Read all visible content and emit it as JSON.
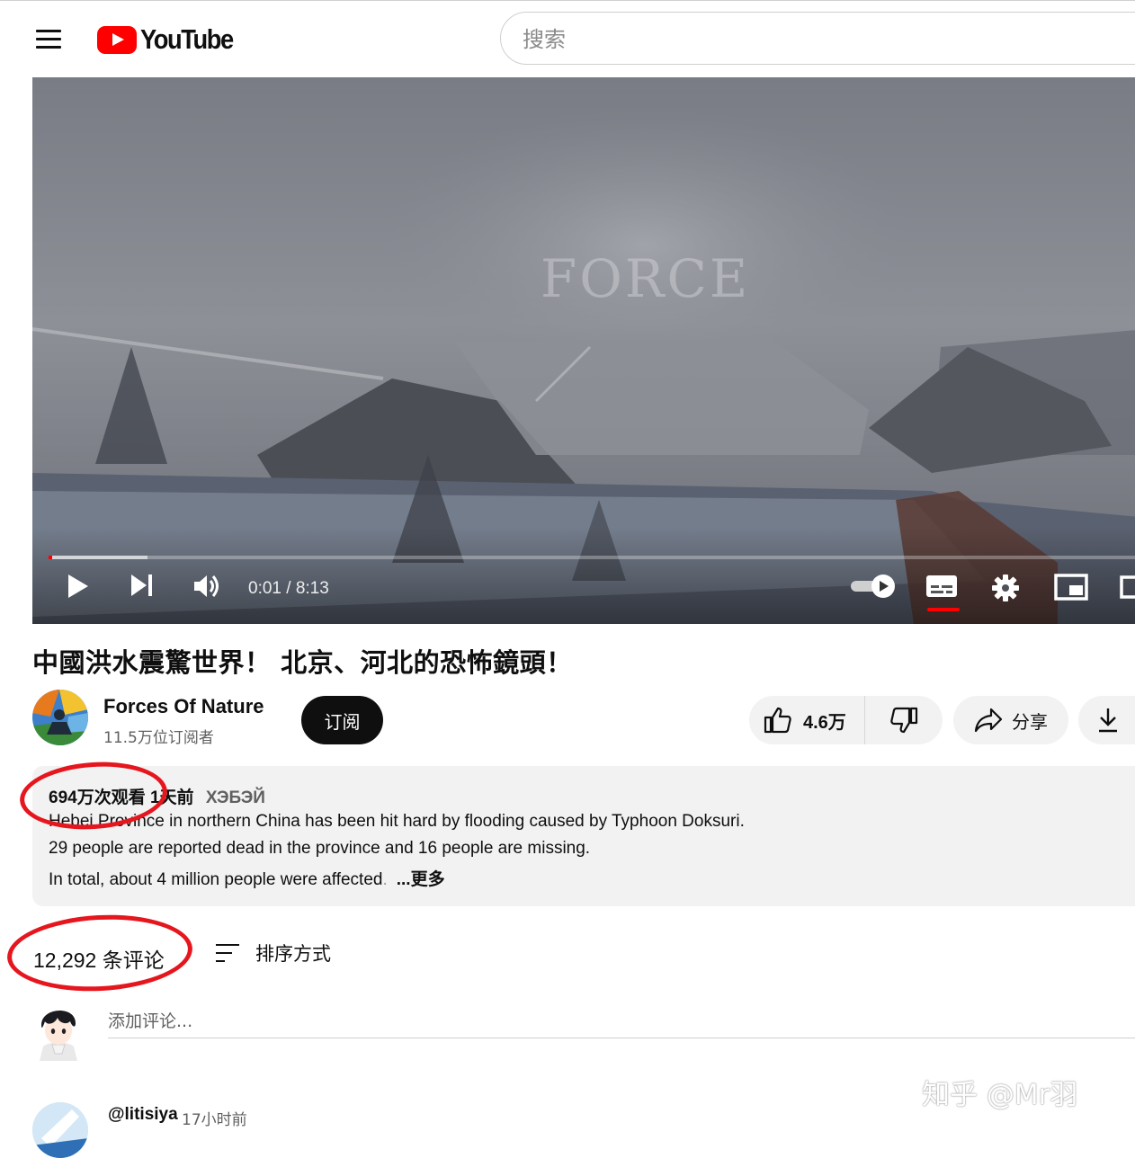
{
  "header": {
    "logo_text": "YouTube",
    "search_placeholder": "搜索"
  },
  "player": {
    "watermark_text": "FORCE",
    "time_current": "0:01",
    "time_total": "8:13",
    "time_display": "0:01 / 8:13",
    "progress_fraction": 0.002,
    "buffer_fraction": 0.09,
    "accent_color": "#ff0000"
  },
  "video": {
    "title": "中國洪水震驚世界！ 北京、河北的恐怖鏡頭！"
  },
  "channel": {
    "name": "Forces Of Nature",
    "subscribers": "11.5万位订阅者",
    "subscribe_label": "订阅"
  },
  "actions": {
    "like_count": "4.6万",
    "share_label": "分享"
  },
  "description": {
    "views": "694万次观看",
    "date": "1天前",
    "tag": "ХЭБЭЙ",
    "lines": [
      "Hebei Province in northern China has been hit hard by flooding caused by Typhoon Doksuri.",
      "29 people are reported dead in the province and 16 people are missing.",
      "In total, about 4 million people were affected"
    ],
    "line3_fade": ".",
    "more_label": "...更多"
  },
  "comments": {
    "count_label": "12,292 条评论",
    "sort_label": "排序方式",
    "add_placeholder": "添加评论...",
    "first": {
      "handle": "@litisiya",
      "time": "17小时前"
    }
  },
  "overlay": {
    "watermark": "知乎 @Mr羽",
    "annotation_color": "#e5161d"
  }
}
